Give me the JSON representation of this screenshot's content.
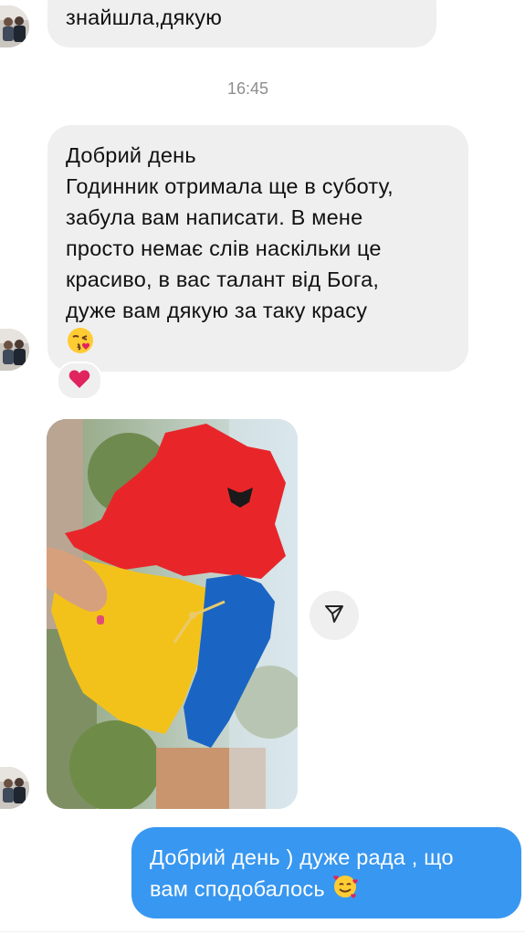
{
  "conversation": {
    "messages": [
      {
        "sender": "contact",
        "text": "знайшла,дякую"
      },
      {
        "sender": "contact",
        "lines": [
          "Добрий день",
          "Годинник отримала ще в суботу,",
          "забула вам написати. В мене",
          "просто немає слів наскільки це",
          "красиво, в вас талант від Бога,",
          "дуже вам дякую за таку красу"
        ],
        "emoji": "kissing-face-with-heart-emoji",
        "reaction": "red-heart-emoji"
      },
      {
        "sender": "contact",
        "type": "photo",
        "subject": "map-shaped clock in red, yellow and blue with clock numerals"
      },
      {
        "sender": "me",
        "lines": [
          "Добрий день ) дуже рада , що",
          "вам сподобалось"
        ],
        "emoji": "smiling-face-with-hearts-emoji"
      }
    ],
    "timestamp": "16:45"
  },
  "colors": {
    "incoming_bubble": "#efefef",
    "outgoing_bubble": "#3897f0",
    "timestamp_text": "#8e8e8e",
    "heart": "#e0245e"
  },
  "icons": {
    "share": "paper-plane-icon",
    "avatar": "contact-avatar"
  }
}
